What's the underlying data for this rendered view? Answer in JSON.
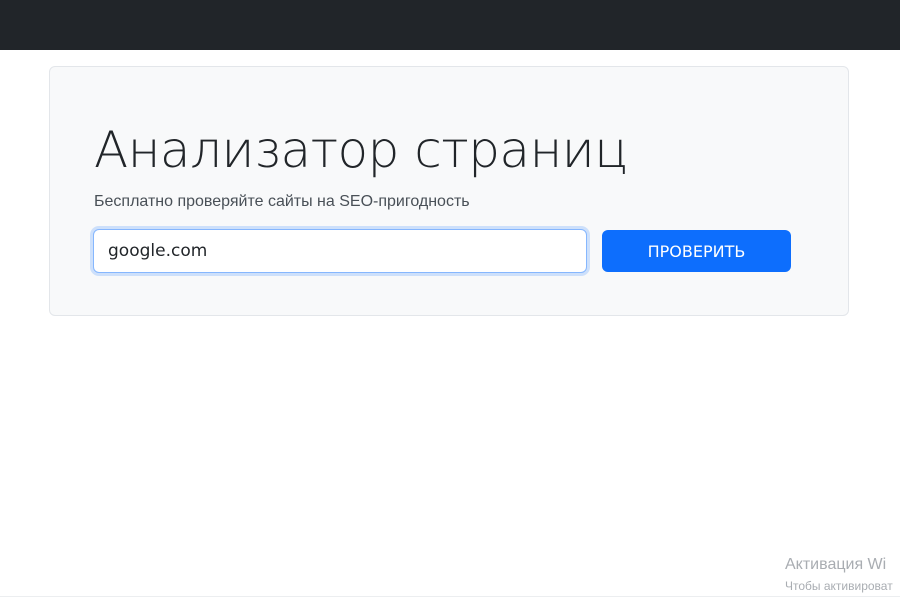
{
  "navbar": {
    "background_color": "#212529"
  },
  "hero": {
    "title": "Анализатор страниц",
    "subtitle": "Бесплатно проверяйте сайты на SEO-пригодность",
    "url_input": {
      "value": "google.com"
    },
    "submit_label": "ПРОВЕРИТЬ",
    "accent_color": "#0d6efd"
  },
  "watermark": {
    "title": "Активация Wi",
    "subtitle": "Чтобы активироват"
  }
}
